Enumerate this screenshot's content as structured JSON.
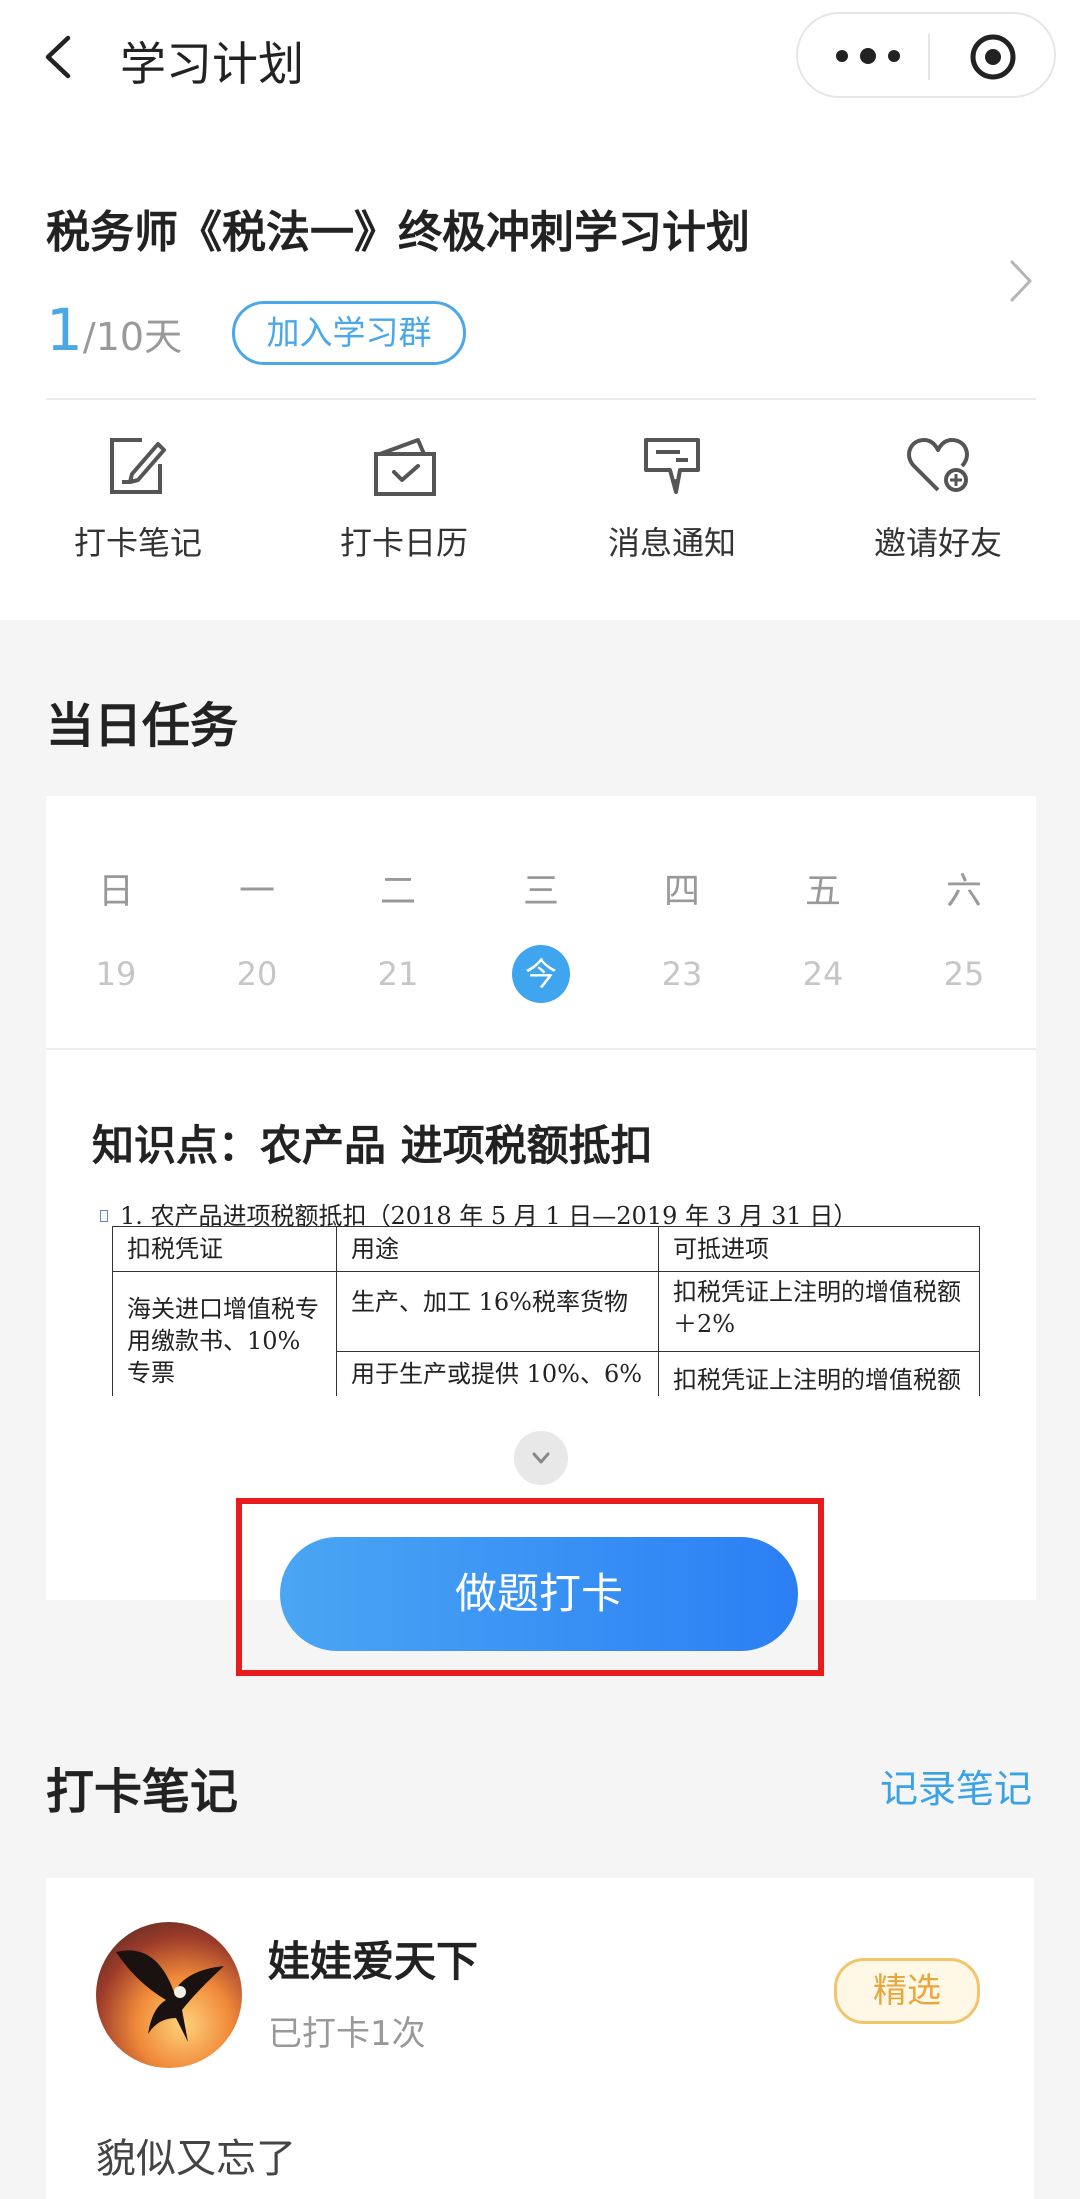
{
  "nav": {
    "title": "学习计划"
  },
  "plan": {
    "title": "税务师《税法一》终极冲刺学习计划",
    "progress_current": "1",
    "progress_total": "/10天",
    "join_label": "加入学习群"
  },
  "actions": [
    {
      "label": "打卡笔记",
      "icon": "note-edit-icon"
    },
    {
      "label": "打卡日历",
      "icon": "calendar-check-icon"
    },
    {
      "label": "消息通知",
      "icon": "message-icon"
    },
    {
      "label": "邀请好友",
      "icon": "heart-add-icon"
    }
  ],
  "task": {
    "section_title": "当日任务",
    "weekdays": [
      "日",
      "一",
      "二",
      "三",
      "四",
      "五",
      "六"
    ],
    "dates": [
      "19",
      "20",
      "21",
      "今",
      "23",
      "24",
      "25"
    ],
    "today_index": 3,
    "knowledge_title": "知识点：农产品 进项税额抵扣",
    "table": {
      "caption": "1. 农产品进项税额抵扣（2018 年 5 月 1 日—2019 年 3 月 31 日）",
      "headers": [
        "扣税凭证",
        "用途",
        "可抵进项"
      ],
      "row1_col1": "海关进口增值税专用缴款书、10%专票",
      "row1_col2": "生产、加工 16%税率货物",
      "row1_col3": "扣税凭证上注明的增值税额＋2%",
      "row2_col2": "用于生产或提供 10%、6%",
      "row2_col3": "扣税凭证上注明的增值税额"
    },
    "cta_label": "做题打卡"
  },
  "notes": {
    "section_title": "打卡笔记",
    "record_label": "记录笔记",
    "item": {
      "user_name": "娃娃爱天下",
      "meta": "已打卡1次",
      "badge": "精选",
      "content": "貌似又忘了"
    }
  },
  "colors": {
    "accent": "#4aa8e8",
    "cta_start": "#4aa6f3",
    "cta_end": "#2b7ff4",
    "highlight": "#e81c1c",
    "badge": "#e9a63c"
  }
}
